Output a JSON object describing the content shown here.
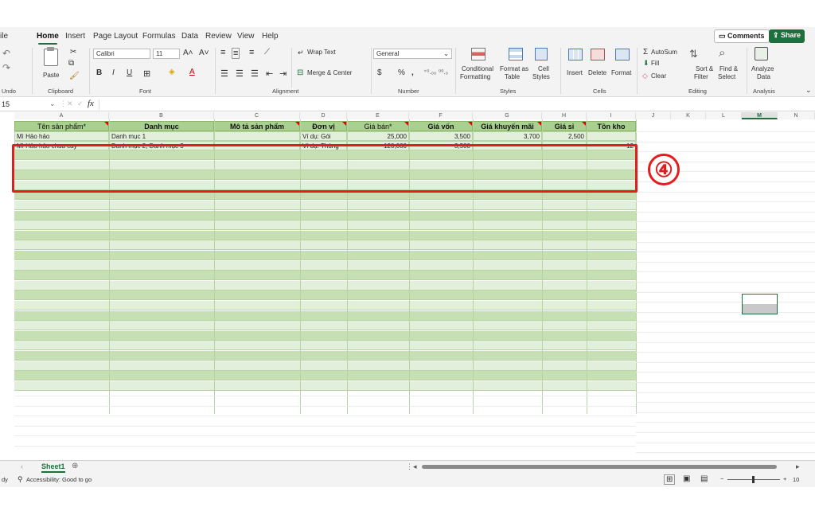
{
  "menu": {
    "tabs": [
      "ile",
      "Home",
      "Insert",
      "Page Layout",
      "Formulas",
      "Data",
      "Review",
      "View",
      "Help"
    ],
    "comments": "Comments",
    "share": "Share"
  },
  "ribbon": {
    "undo": "Undo",
    "clipboard": {
      "paste": "Paste",
      "label": "Clipboard"
    },
    "font": {
      "name": "Calibri",
      "size": "11",
      "label": "Font",
      "bold": "B",
      "italic": "I",
      "underline": "U"
    },
    "alignment": {
      "wrap_text": "Wrap Text",
      "merge_center": "Merge & Center",
      "label": "Alignment"
    },
    "number": {
      "format": "General",
      "currency": "$",
      "percent": "%",
      "comma": ",",
      "label": "Number"
    },
    "styles": {
      "conditional": "Conditional",
      "conditional2": "Formatting",
      "format_as": "Format as",
      "format_as2": "Table",
      "cell": "Cell",
      "cell2": "Styles",
      "label": "Styles"
    },
    "cells": {
      "insert": "Insert",
      "delete": "Delete",
      "format": "Format",
      "label": "Cells"
    },
    "editing": {
      "autosum": "AutoSum",
      "fill": "Fill",
      "clear": "Clear",
      "sort": "Sort &",
      "sort2": "Filter",
      "find": "Find &",
      "find2": "Select",
      "label": "Editing"
    },
    "analysis": {
      "analyze": "Analyze",
      "analyze2": "Data",
      "label": "Analysis"
    }
  },
  "formula_bar": {
    "name_box": "15",
    "fx": "fx",
    "value": ""
  },
  "columns": [
    "A",
    "B",
    "C",
    "D",
    "E",
    "F",
    "G",
    "H",
    "I",
    "J",
    "K",
    "L",
    "M",
    "N"
  ],
  "header_row": [
    "Tên sản phẩm*",
    "Danh mục",
    "Mô tả sản phẩm",
    "Đơn vị",
    "Giá bán*",
    "Giá vốn",
    "Giá khuyến mãi",
    "Giá sỉ",
    "Tồn kho"
  ],
  "rows": [
    [
      "Mì Hảo hảo",
      "Danh mục 1",
      "",
      "Ví dụ: Gói",
      "25,000",
      "3,500",
      "3,700",
      "2,500",
      ""
    ],
    [
      "Mì Hảo hảo chua cay",
      "Danh mục 2, Danh mục 3",
      "",
      "Ví dụ: Thùng",
      "120,000",
      "3,500",
      "",
      "",
      "12"
    ]
  ],
  "annotation": "④",
  "sheet_tab": "Sheet1",
  "status": {
    "left": "dy",
    "accessibility": "Accessibility: Good to go",
    "zoom": "10"
  },
  "colors": {
    "accent": "#1e6e3e",
    "header_fill": "#a9d08e",
    "row_fill": "#e2efda",
    "highlight": "#e11d1d"
  }
}
